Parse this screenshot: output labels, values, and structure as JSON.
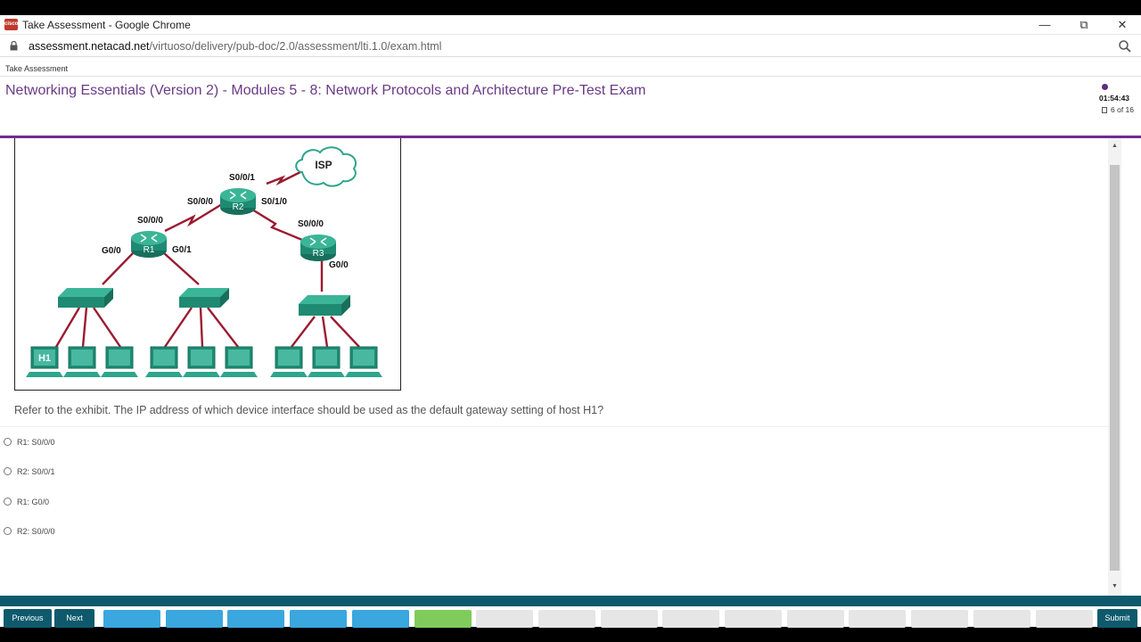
{
  "window": {
    "favicon_text": "cisco",
    "title": "Take Assessment - Google Chrome",
    "minimize": "—",
    "restore": "⧉",
    "close": "✕"
  },
  "address": {
    "host": "assessment.netacad.net",
    "path": "/virtuoso/delivery/pub-doc/2.0/assessment/lti.1.0/exam.html"
  },
  "header": {
    "breadcrumb": "Take Assessment",
    "title": "Networking Essentials (Version 2) - Modules 5 - 8: Network Protocols and Architecture Pre-Test Exam",
    "timer": "01:54:43",
    "progress": "6 of 16"
  },
  "exhibit": {
    "isp": "ISP",
    "r1": "R1",
    "r2": "R2",
    "r3": "R3",
    "h1": "H1",
    "r2_s001": "S0/0/1",
    "r2_s000": "S0/0/0",
    "r2_s010": "S0/1/0",
    "r1_s000": "S0/0/0",
    "r1_g00": "G0/0",
    "r1_g01": "G0/1",
    "r3_s000": "S0/0/0",
    "r3_g00": "G0/0"
  },
  "question": {
    "text": "Refer to the exhibit. The IP address of which device interface should be used as the default gateway setting of host H1?",
    "options": [
      "R1: S0/0/0",
      "R2: S0/0/1",
      "R1: G0/0",
      "R2: S0/0/0"
    ]
  },
  "nav": {
    "previous": "Previous",
    "next": "Next",
    "submit": "Submit",
    "tab_states": [
      "answered",
      "answered",
      "answered",
      "answered",
      "answered",
      "current",
      "empty",
      "empty",
      "empty",
      "empty",
      "empty",
      "empty",
      "empty",
      "empty",
      "empty",
      "empty"
    ]
  },
  "colors": {
    "accent": "#6f2c91",
    "teal": "#0e5a6c",
    "answered": "#3aa7df",
    "current": "#7fcc5c",
    "empty": "#e6e6e6"
  }
}
